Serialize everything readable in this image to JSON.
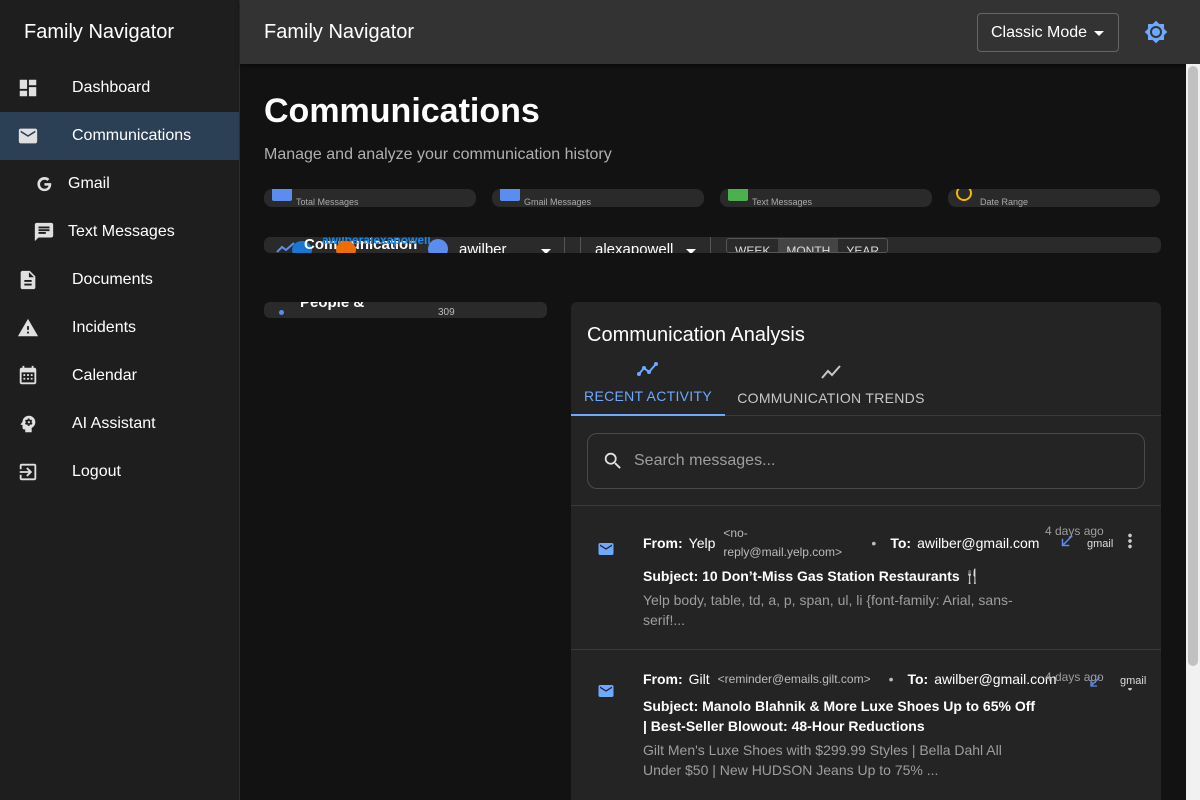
{
  "app": {
    "name": "Family Navigator"
  },
  "sidebar": {
    "items": [
      {
        "label": "Dashboard"
      },
      {
        "label": "Communications"
      },
      {
        "label": "Gmail"
      },
      {
        "label": "Text Messages"
      },
      {
        "label": "Documents"
      },
      {
        "label": "Incidents"
      },
      {
        "label": "Calendar"
      },
      {
        "label": "AI Assistant"
      },
      {
        "label": "Logout"
      }
    ]
  },
  "header": {
    "title": "Family Navigator",
    "mode": "Classic Mode"
  },
  "page": {
    "title": "Communications",
    "subtitle": "Manage and analyze your communication history"
  },
  "stats": [
    {
      "label": "Total Messages",
      "color": "#5b8def"
    },
    {
      "label": "Gmail Messages",
      "color": "#5b8def"
    },
    {
      "label": "Text Messages",
      "color": "#4caf50"
    },
    {
      "label": "Date Range",
      "color": "#f5b800"
    }
  ],
  "filters": {
    "title": "Communication",
    "overlay_text": "awilberalexapowell",
    "person1": "awilber",
    "person2": "alexapowell",
    "periods": [
      "WEEK",
      "MONTH",
      "YEAR"
    ],
    "selected_period": "MONTH"
  },
  "people": {
    "title": "People &",
    "count": "309"
  },
  "analysis": {
    "title": "Communication Analysis",
    "tabs": [
      {
        "label": "RECENT ACTIVITY"
      },
      {
        "label": "COMMUNICATION TRENDS"
      }
    ],
    "search_placeholder": "Search messages...",
    "messages": [
      {
        "from_label": "From:",
        "from_name": "Yelp",
        "from_email": "<no-reply@mail.yelp.com>",
        "to_label": "To:",
        "to": "awilber@gmail.com",
        "subject": "Subject: 10 Don’t-Miss Gas Station Restaurants 🍴",
        "preview": "Yelp body, table, td, a, p, span, ul, li {font-family: Arial, sans-serif!...",
        "time": "4 days ago",
        "source": "gmail"
      },
      {
        "from_label": "From:",
        "from_name": "Gilt",
        "from_email": "<reminder@emails.gilt.com>",
        "to_label": "To:",
        "to": "awilber@gmail.com",
        "subject": "Subject: Manolo Blahnik & More Luxe Shoes Up to 65% Off | Best-Seller Blowout: 48-Hour Reductions",
        "preview": "Gilt Men's Luxe Shoes with $299.99 Styles | Bella Dahl All Under $50 | New HUDSON Jeans Up to 75% ...",
        "time": "4 days ago",
        "source": "gmail"
      }
    ]
  },
  "colors": {
    "accent": "#6ea8ff",
    "active_nav": "#2b3f55",
    "appbar": "#333333"
  }
}
